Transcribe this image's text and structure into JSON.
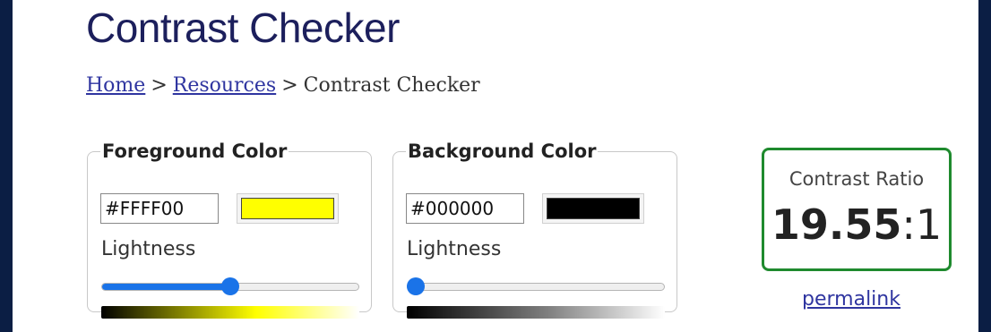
{
  "page": {
    "title": "Contrast Checker"
  },
  "breadcrumb": {
    "home": "Home",
    "resources": "Resources",
    "current": "Contrast Checker",
    "separator": ">"
  },
  "foreground": {
    "legend": "Foreground Color",
    "hex_value": "#FFFF00",
    "swatch_color": "#ffff00",
    "lightness_label": "Lightness",
    "lightness_fraction": 0.5
  },
  "background": {
    "legend": "Background Color",
    "hex_value": "#000000",
    "swatch_color": "#000000",
    "lightness_label": "Lightness",
    "lightness_fraction": 0.0
  },
  "result": {
    "label": "Contrast Ratio",
    "ratio_bold": "19.55",
    "ratio_suffix": ":1",
    "border_color": "#1f8a2e"
  },
  "permalink": "permalink",
  "colors": {
    "accent": "#1a73e8",
    "link": "#2f35a0",
    "frame": "#0b1e44"
  }
}
